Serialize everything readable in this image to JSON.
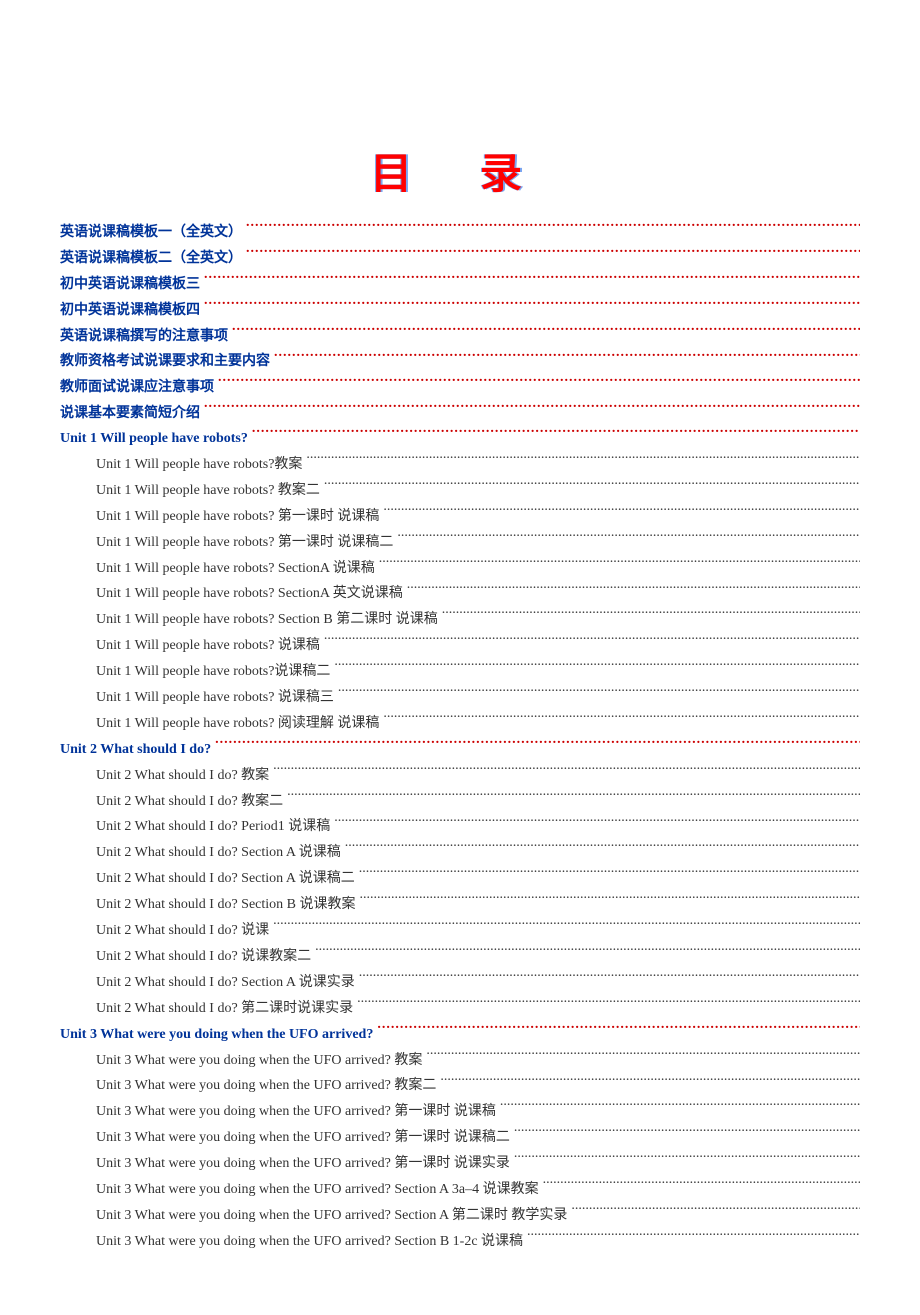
{
  "title": "目 录",
  "toc": [
    {
      "label": "英语说课稿模板一（全英文）",
      "level": 0,
      "style": "blue",
      "dots": "red"
    },
    {
      "label": "英语说课稿模板二（全英文）",
      "level": 0,
      "style": "blue",
      "dots": "red"
    },
    {
      "label": "初中英语说课稿模板三",
      "level": 0,
      "style": "blue",
      "dots": "red"
    },
    {
      "label": "初中英语说课稿模板四",
      "level": 0,
      "style": "blue",
      "dots": "red"
    },
    {
      "label": "英语说课稿撰写的注意事项",
      "level": 0,
      "style": "blue",
      "dots": "red"
    },
    {
      "label": "教师资格考试说课要求和主要内容",
      "level": 0,
      "style": "blue",
      "dots": "red"
    },
    {
      "label": "教师面试说课应注意事项",
      "level": 0,
      "style": "blue",
      "dots": "red"
    },
    {
      "label": "说课基本要素简短介绍",
      "level": 0,
      "style": "blue",
      "dots": "red"
    },
    {
      "label": "Unit 1 Will people have robots?",
      "level": 0,
      "style": "blue-en",
      "dots": "red"
    },
    {
      "label": "Unit 1 Will people have robots?教案",
      "level": 1,
      "style": "plain",
      "dots": "black"
    },
    {
      "label": "Unit 1 Will people have robots?   教案二",
      "level": 1,
      "style": "plain",
      "dots": "black"
    },
    {
      "label": "Unit 1 Will people have robots?  第一课时  说课稿",
      "level": 1,
      "style": "plain",
      "dots": "black"
    },
    {
      "label": "Unit 1 Will people have robots?  第一课时  说课稿二",
      "level": 1,
      "style": "plain",
      "dots": "black"
    },
    {
      "label": "Unit 1 Will people have robots? SectionA  说课稿",
      "level": 1,
      "style": "plain",
      "dots": "black"
    },
    {
      "label": "Unit 1 Will people have robots? SectionA  英文说课稿",
      "level": 1,
      "style": "plain",
      "dots": "black"
    },
    {
      "label": "Unit 1 Will people have robots? Section B 第二课时  说课稿",
      "level": 1,
      "style": "plain",
      "dots": "black"
    },
    {
      "label": "Unit 1 Will people have robots?  说课稿",
      "level": 1,
      "style": "plain",
      "dots": "black"
    },
    {
      "label": "Unit 1 Will people have robots?说课稿二",
      "level": 1,
      "style": "plain",
      "dots": "black"
    },
    {
      "label": "Unit 1 Will people have robots?  说课稿三",
      "level": 1,
      "style": "plain",
      "dots": "black"
    },
    {
      "label": "Unit 1 Will people have robots?  阅读理解  说课稿",
      "level": 1,
      "style": "plain",
      "dots": "black"
    },
    {
      "label": "Unit 2 What should I do?",
      "level": 0,
      "style": "blue-en",
      "dots": "red"
    },
    {
      "label": "Unit 2 What should I do?  教案",
      "level": 1,
      "style": "plain",
      "dots": "black"
    },
    {
      "label": "Unit 2 What should I do?  教案二",
      "level": 1,
      "style": "plain",
      "dots": "black"
    },
    {
      "label": "Unit 2 What should I do? Period1 说课稿",
      "level": 1,
      "style": "plain",
      "dots": "black"
    },
    {
      "label": "Unit 2 What should I do? Section A 说课稿",
      "level": 1,
      "style": "plain",
      "dots": "black"
    },
    {
      "label": "Unit 2 What should I do? Section A 说课稿二",
      "level": 1,
      "style": "plain",
      "dots": "black"
    },
    {
      "label": "Unit 2 What should I do? Section B 说课教案",
      "level": 1,
      "style": "plain",
      "dots": "black"
    },
    {
      "label": "Unit 2 What should I do?  说课",
      "level": 1,
      "style": "plain",
      "dots": "black"
    },
    {
      "label": "Unit 2 What should I do?  说课教案二",
      "level": 1,
      "style": "plain",
      "dots": "black"
    },
    {
      "label": "Unit 2 What should I do? Section A  说课实录",
      "level": 1,
      "style": "plain",
      "dots": "black"
    },
    {
      "label": "Unit 2 What should I do?  第二课时说课实录",
      "level": 1,
      "style": "plain",
      "dots": "black"
    },
    {
      "label": "Unit 3 What were you doing when the UFO arrived?",
      "level": 0,
      "style": "blue-en",
      "dots": "red"
    },
    {
      "label": "Unit 3 What were you doing when the UFO arrived?  教案",
      "level": 1,
      "style": "plain",
      "dots": "black"
    },
    {
      "label": "Unit 3 What were you doing when the UFO arrived?  教案二",
      "level": 1,
      "style": "plain",
      "dots": "black"
    },
    {
      "label": "Unit 3 What were you doing when the UFO arrived?  第一课时  说课稿",
      "level": 1,
      "style": "plain",
      "dots": "black"
    },
    {
      "label": "Unit 3 What were you doing when the UFO arrived?  第一课时  说课稿二",
      "level": 1,
      "style": "plain",
      "dots": "black"
    },
    {
      "label": "Unit 3 What were you doing when the UFO arrived?  第一课时  说课实录",
      "level": 1,
      "style": "plain",
      "dots": "black"
    },
    {
      "label": "Unit 3 What were you doing when the UFO arrived? Section A 3a–4  说课教案",
      "level": 1,
      "style": "plain",
      "dots": "black"
    },
    {
      "label": "Unit 3 What were you doing when the UFO arrived? Section A  第二课时  教学实录",
      "level": 1,
      "style": "plain",
      "dots": "black"
    },
    {
      "label": "Unit 3 What were you doing when the UFO arrived? Section B 1-2c  说课稿",
      "level": 1,
      "style": "plain",
      "dots": "black"
    }
  ]
}
